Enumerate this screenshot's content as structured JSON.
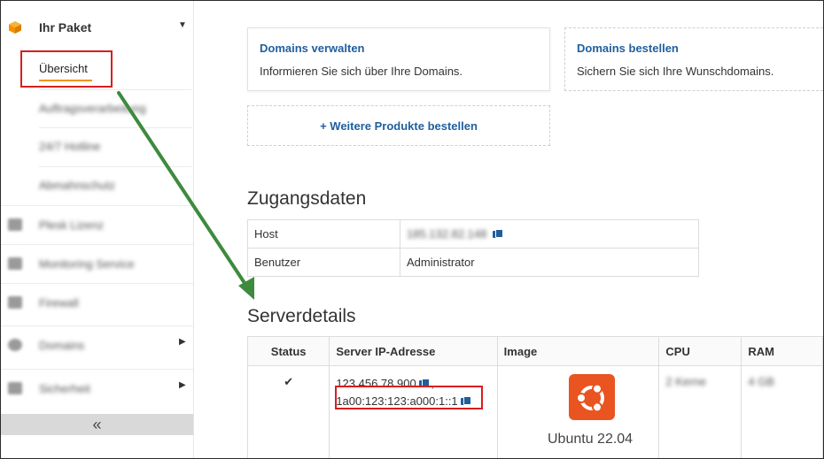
{
  "sidebar": {
    "package_title": "Ihr Paket",
    "subitems": [
      {
        "label": "Übersicht",
        "active": true
      },
      {
        "label": "Auftragsverarbeitung",
        "active": false
      },
      {
        "label": "24/7 Hotline",
        "active": false
      },
      {
        "label": "Abmahnschutz",
        "active": false
      }
    ],
    "items": [
      {
        "label": "Plesk Lizenz",
        "has_submenu": false
      },
      {
        "label": "Monitoring Service",
        "has_submenu": false
      },
      {
        "label": "Firewall",
        "has_submenu": false
      },
      {
        "label": "Domains",
        "has_submenu": true
      },
      {
        "label": "Sicherheit",
        "has_submenu": true
      }
    ],
    "collapse_label": "«"
  },
  "cards": {
    "domains_manage": {
      "title": "Domains verwalten",
      "desc": "Informieren Sie sich über Ihre Domains."
    },
    "domains_order": {
      "title": "Domains bestellen",
      "desc": "Sichern Sie sich Ihre Wunschdomains."
    },
    "more_products": "Weitere Produkte bestellen",
    "more_products_icon": "+"
  },
  "access": {
    "heading": "Zugangsdaten",
    "rows": [
      {
        "label": "Host",
        "value": "185.132.82.148"
      },
      {
        "label": "Benutzer",
        "value": "Administrator"
      }
    ]
  },
  "server": {
    "heading": "Serverdetails",
    "columns": [
      "Status",
      "Server IP-Adresse",
      "Image",
      "CPU",
      "RAM"
    ],
    "row": {
      "status_icon": "✔",
      "ipv4": "123.456.78.900",
      "separator": ",",
      "ipv6": "1a00:123:123:a000:1::1",
      "image": "Ubuntu 22.04",
      "cpu": "2 Kerne",
      "ram": "4 GB"
    }
  },
  "colors": {
    "accent": "#f39200",
    "link": "#1f5f9e",
    "highlight": "#d81e1e",
    "ubuntu": "#e95420"
  }
}
